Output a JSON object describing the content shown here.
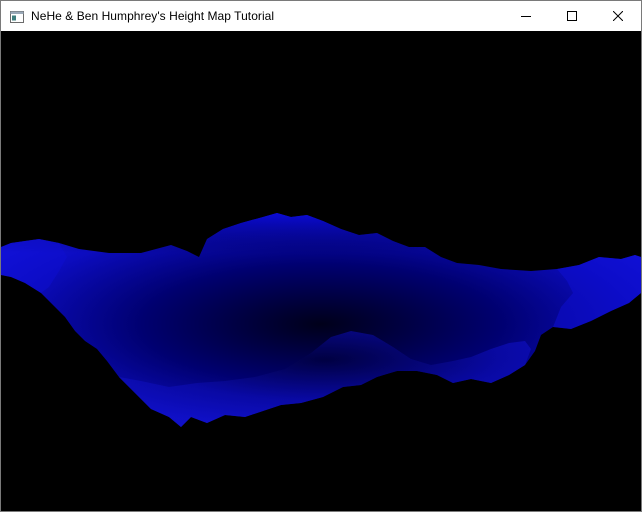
{
  "window": {
    "title": "NeHe & Ben Humphrey's Height Map Tutorial",
    "app_icon": "application-window-icon",
    "controls": {
      "minimize_icon": "minimize-icon",
      "maximize_icon": "maximize-icon",
      "close_icon": "close-icon"
    }
  },
  "viewport": {
    "description_icon": "terrain-render",
    "background_color": "#000000",
    "terrain_color_light": "#1010d8",
    "terrain_color_dark": "#00001a"
  }
}
